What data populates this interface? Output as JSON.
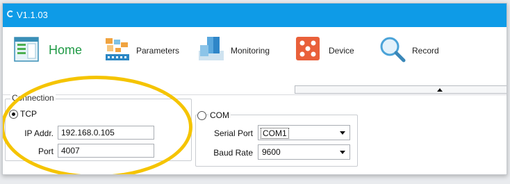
{
  "window": {
    "title": "V1.1.03"
  },
  "ribbon": {
    "items": [
      {
        "label": "Home",
        "icon": "home-window-icon"
      },
      {
        "label": "Parameters",
        "icon": "parameters-icon"
      },
      {
        "label": "Monitoring",
        "icon": "monitoring-icon"
      },
      {
        "label": "Device",
        "icon": "device-icon"
      },
      {
        "label": "Record",
        "icon": "magnifier-icon"
      }
    ],
    "home_color": "#1f9a45"
  },
  "connection": {
    "legend": "Connection",
    "tcp": {
      "label": "TCP",
      "selected": true,
      "ip_label": "IP Addr.",
      "ip_value": "192.168.0.105",
      "port_label": "Port",
      "port_value": "4007"
    },
    "com": {
      "label": "COM",
      "selected": false,
      "serial_label": "Serial Port",
      "serial_value": "COM1",
      "baud_label": "Baud Rate",
      "baud_value": "9600"
    }
  },
  "colors": {
    "titlebar": "#0e9be7",
    "highlight": "#f5c400"
  }
}
